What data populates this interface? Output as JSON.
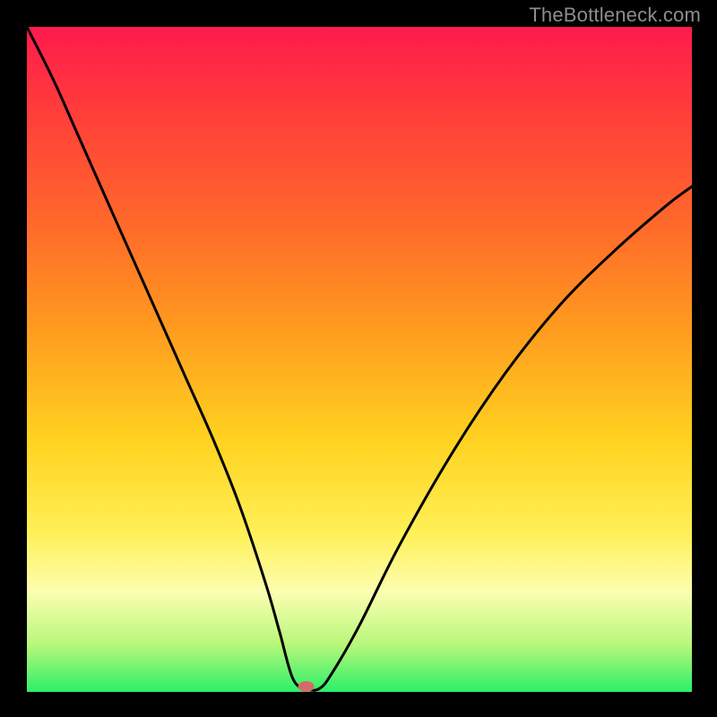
{
  "watermark": "TheBottleneck.com",
  "marker": {
    "fill": "#d46a6a",
    "rx": 9,
    "ry": 6
  },
  "chart_data": {
    "type": "line",
    "title": "",
    "xlabel": "",
    "ylabel": "",
    "xlim": [
      0,
      100
    ],
    "ylim": [
      0,
      100
    ],
    "grid": false,
    "legend": false,
    "min_x": 42,
    "series": [
      {
        "name": "bottleneck-curve",
        "x": [
          0,
          4,
          8,
          12,
          16,
          20,
          24,
          28,
          32,
          36,
          38,
          40,
          42,
          44,
          46,
          50,
          56,
          64,
          72,
          80,
          88,
          96,
          100
        ],
        "y": [
          100,
          92,
          83,
          74,
          65,
          56,
          47,
          38,
          28,
          16,
          9,
          2,
          0.5,
          0.5,
          3,
          10,
          22,
          36,
          48,
          58,
          66,
          73,
          76
        ]
      }
    ]
  }
}
